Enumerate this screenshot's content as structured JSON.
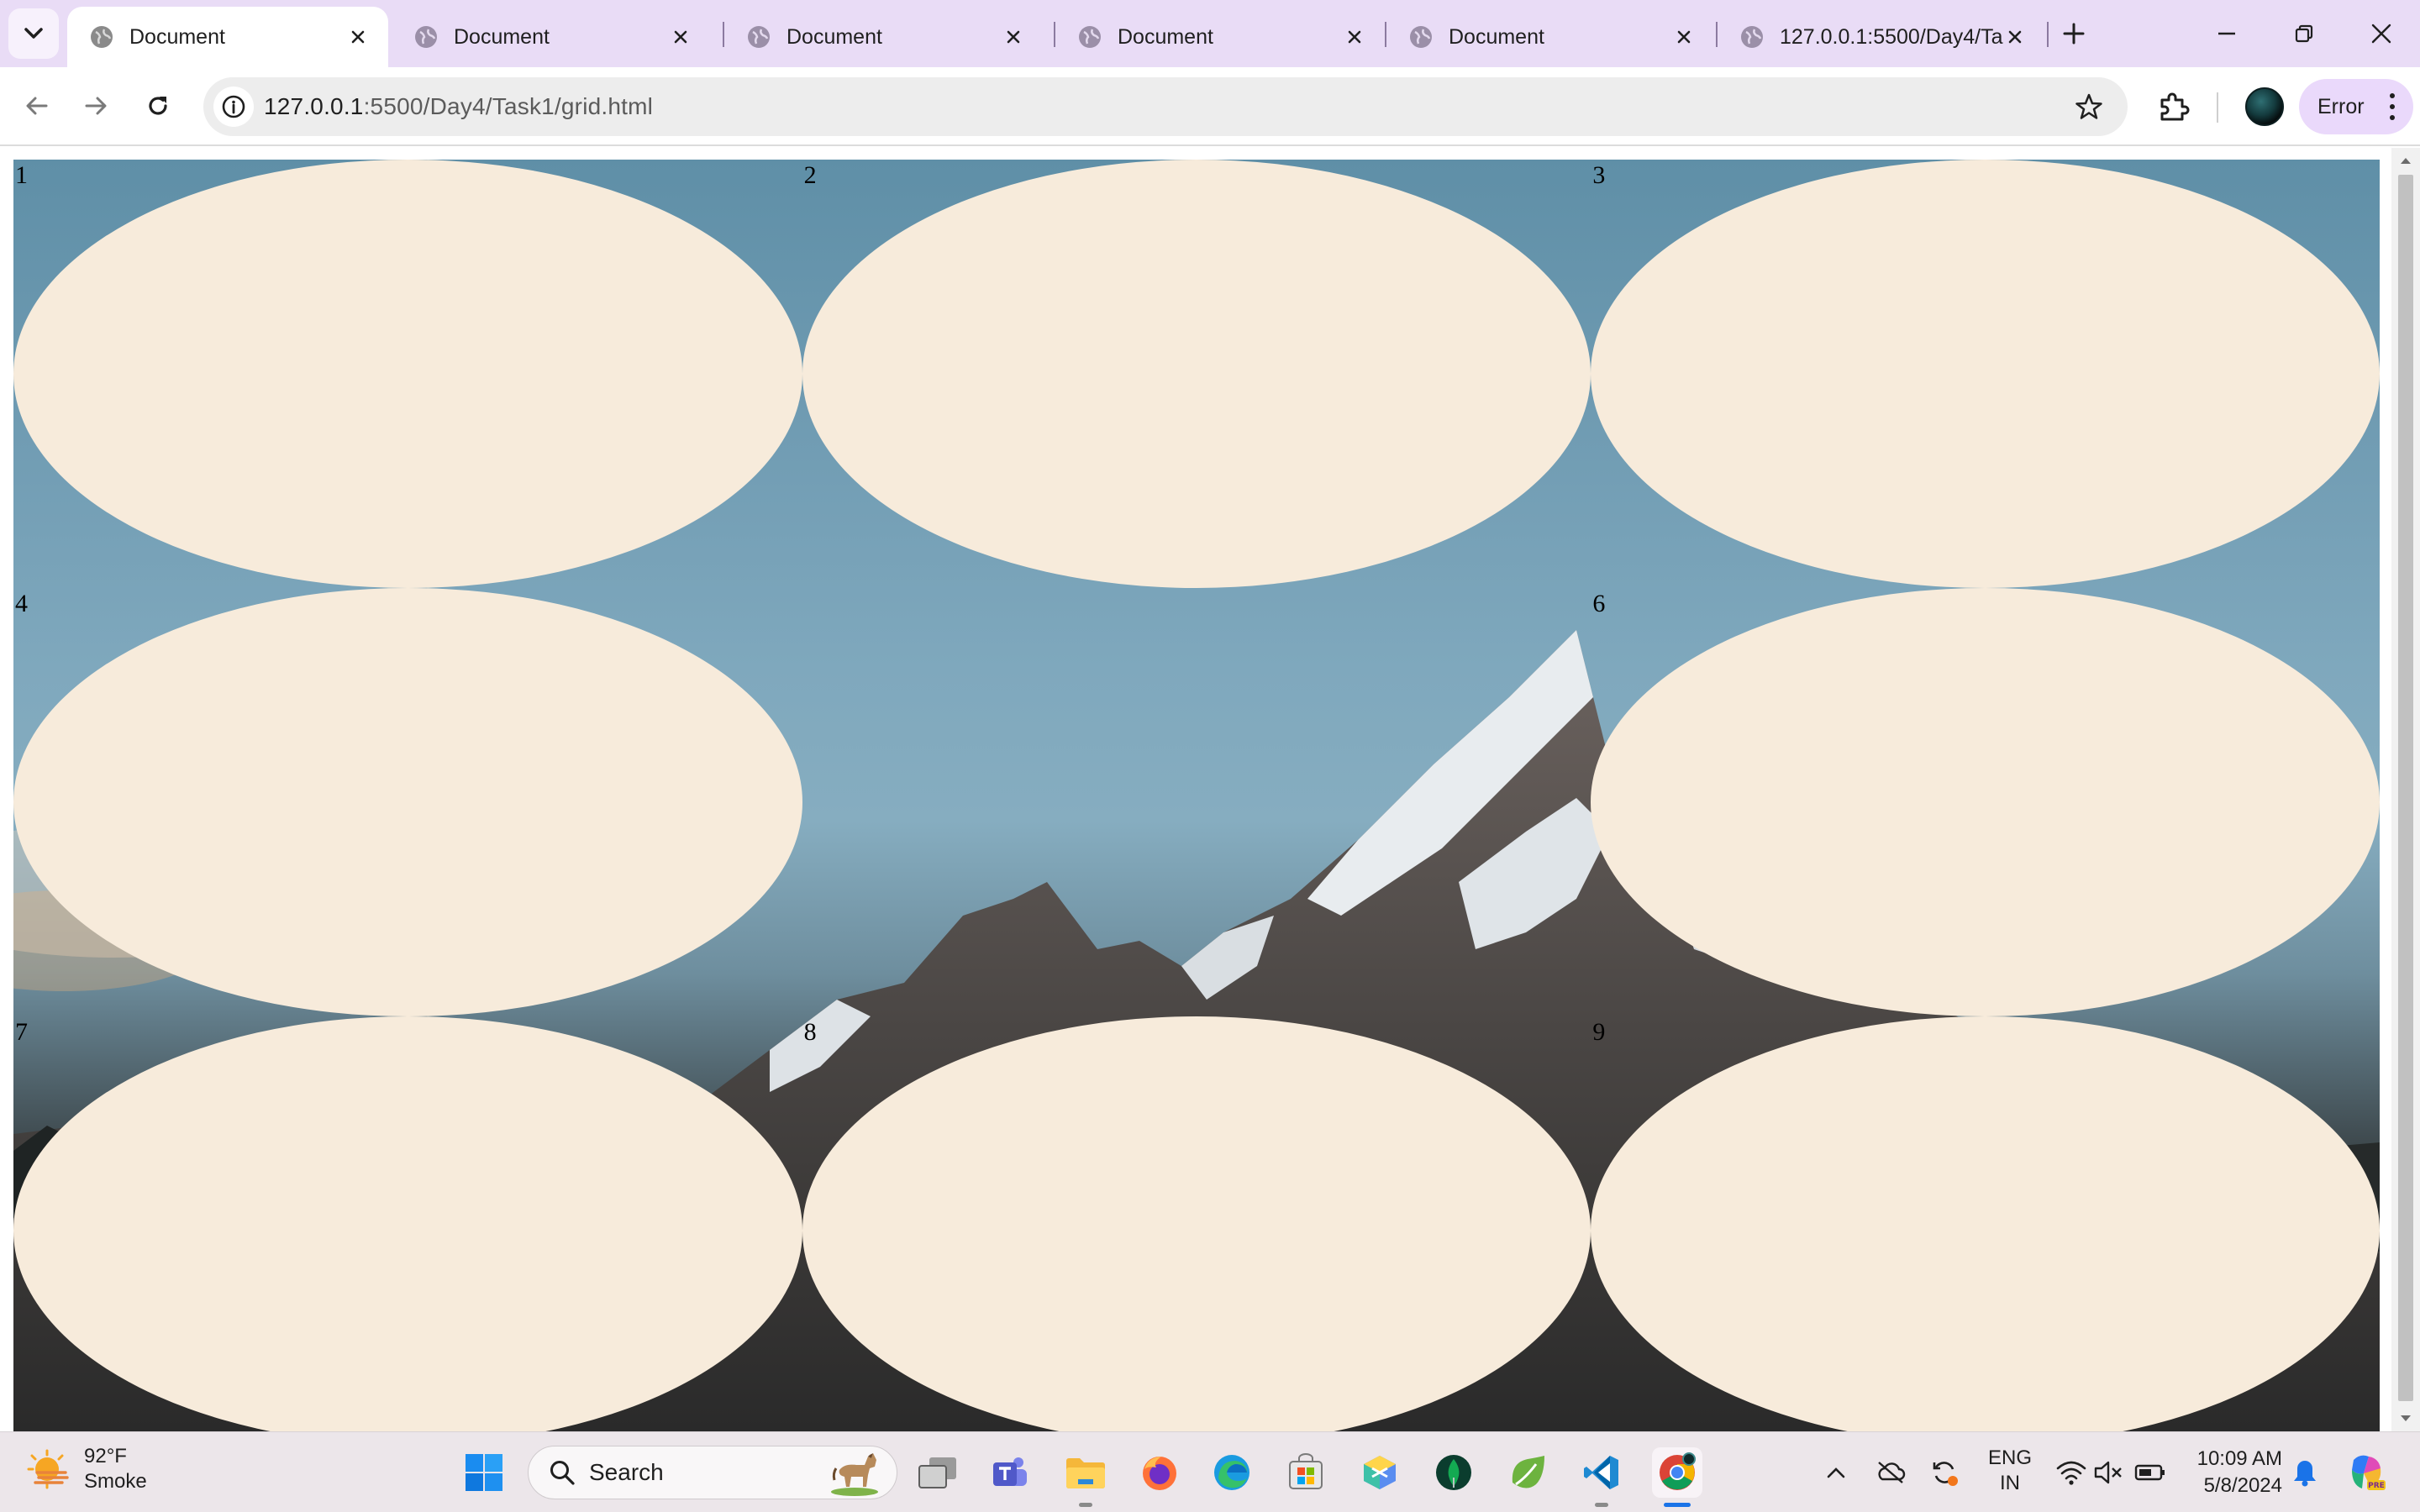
{
  "browser": {
    "tabs": [
      {
        "title": "Document",
        "active": true
      },
      {
        "title": "Document",
        "active": false
      },
      {
        "title": "Document",
        "active": false
      },
      {
        "title": "Document",
        "active": false
      },
      {
        "title": "Document",
        "active": false
      },
      {
        "title": "127.0.0.1:5500/Day4/Task1/grid.html",
        "active": false
      }
    ],
    "url_host": "127.0.0.1",
    "url_rest": ":5500/Day4/Task1/grid.html",
    "error_label": "Error"
  },
  "page": {
    "grid_items": [
      {
        "label": "1",
        "filled": true
      },
      {
        "label": "2",
        "filled": true
      },
      {
        "label": "3",
        "filled": true
      },
      {
        "label": "4",
        "filled": true
      },
      {
        "label": "",
        "filled": false
      },
      {
        "label": "6",
        "filled": true
      },
      {
        "label": "7",
        "filled": true
      },
      {
        "label": "8",
        "filled": true
      },
      {
        "label": "9",
        "filled": true
      }
    ],
    "ellipse_color": "#f7ebdb"
  },
  "taskbar": {
    "weather_temp": "92°F",
    "weather_condition": "Smoke",
    "search_label": "Search",
    "apps": [
      "start-icon",
      "task-view-icon",
      "teams-icon",
      "file-explorer-icon",
      "firefox-icon",
      "edge-icon",
      "store-icon",
      "app-cube-icon",
      "mongodb-icon",
      "spring-icon",
      "vscode-icon",
      "chrome-icon"
    ],
    "language_line1": "ENG",
    "language_line2": "IN",
    "time": "10:09 AM",
    "date": "5/8/2024"
  }
}
